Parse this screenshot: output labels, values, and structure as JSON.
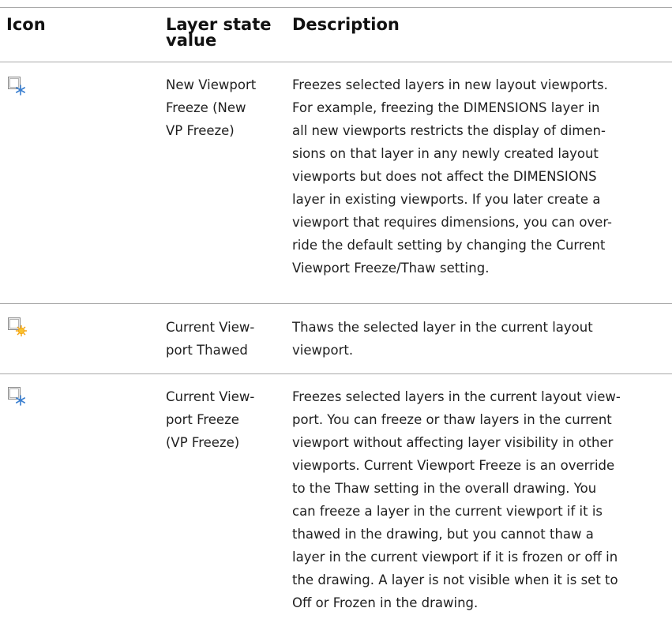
{
  "header": {
    "icon": "Icon",
    "value_line1": "Layer state",
    "value_line2": "value",
    "description": "Description"
  },
  "rows": [
    {
      "icon": "new-vp-freeze-icon",
      "value_lines": [
        "New Viewport",
        "Freeze (New",
        "VP Freeze)"
      ],
      "description_lines": [
        "Freezes selected layers in new layout viewports.",
        "For example, freezing the DIMENSIONS layer in",
        "all new viewports restricts the display of dimen-",
        "sions on that layer in any newly created layout",
        "viewports but does not affect the DIMENSIONS",
        "layer in existing viewports. If you later create a",
        "viewport that requires dimensions, you can over-",
        "ride the default setting by changing the Current",
        "Viewport Freeze/Thaw setting."
      ]
    },
    {
      "icon": "current-vp-thawed-icon",
      "value_lines": [
        "Current View-",
        "port Thawed"
      ],
      "description_lines": [
        "Thaws the selected layer in the current layout",
        "viewport."
      ]
    },
    {
      "icon": "current-vp-freeze-icon",
      "value_lines": [
        "Current View-",
        "port Freeze",
        "(VP Freeze)"
      ],
      "description_lines": [
        "Freezes selected layers in the current layout view-",
        "port. You can freeze or thaw layers in the current",
        "viewport without affecting layer visibility in other",
        "viewports. Current Viewport Freeze is an override",
        "to the Thaw setting in the overall drawing. You",
        "can freeze a layer in the current viewport if it is",
        "thawed in the drawing, but you cannot thaw a",
        "layer in the current viewport if it is frozen or off in",
        "the drawing. A layer is not visible when it is set to",
        "Off or Frozen in the drawing."
      ]
    }
  ],
  "colors": {
    "rule": "#a9a9a9",
    "snowflake": "#3a7fd0",
    "sun": "#f4a20c"
  }
}
